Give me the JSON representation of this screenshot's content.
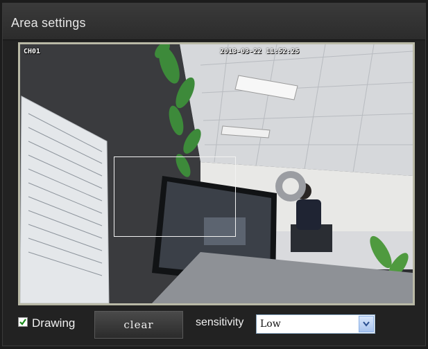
{
  "window": {
    "title": "Area settings"
  },
  "video": {
    "channel": "CH01",
    "timestamp": "2013-03-22 11:52:25"
  },
  "controls": {
    "drawing_checked": true,
    "drawing_label": "Drawing",
    "clear_label": "clear",
    "sensitivity_label": "sensitivity",
    "sensitivity_value": "Low"
  },
  "colors": {
    "frame_border": "#b9b9a6",
    "region_border": "#f2f2f2",
    "checkmark": "#1a8a1a",
    "dropdown_arrow": "#2a4f8f"
  },
  "icons": {
    "checkbox": "check-icon",
    "dropdown": "chevron-down-icon"
  }
}
